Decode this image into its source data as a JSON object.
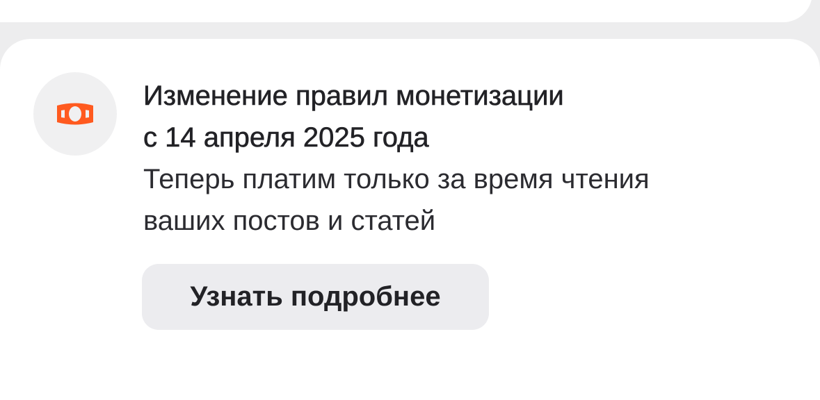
{
  "notice": {
    "icon": "money-bill-icon",
    "accent_color": "#ff5a1f",
    "title_lines": [
      "Изменение правил монетизации",
      "с 14 апреля 2025 года"
    ],
    "description_lines": [
      "Теперь платим только за время чтения",
      "ваших постов и статей"
    ],
    "button_label": "Узнать подробнее"
  }
}
